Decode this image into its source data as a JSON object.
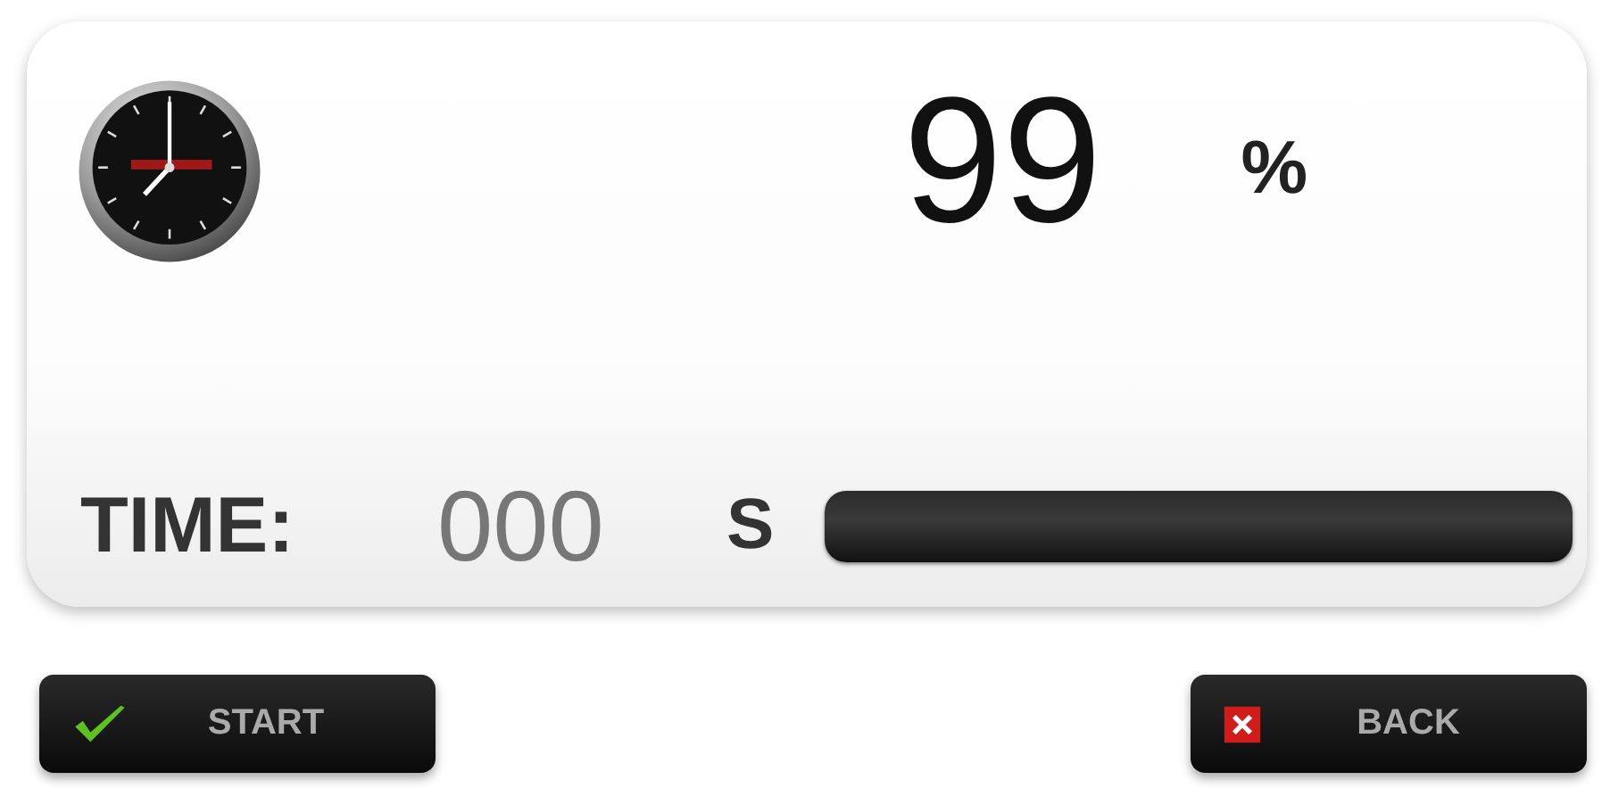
{
  "progress": {
    "value": "99",
    "unit": "%"
  },
  "timer": {
    "label": "TIME:",
    "value": "000",
    "unit": "S",
    "level": 0
  },
  "buttons": [
    {
      "kind": "start",
      "label": "START"
    },
    {
      "kind": "back",
      "label": "BACK"
    }
  ]
}
